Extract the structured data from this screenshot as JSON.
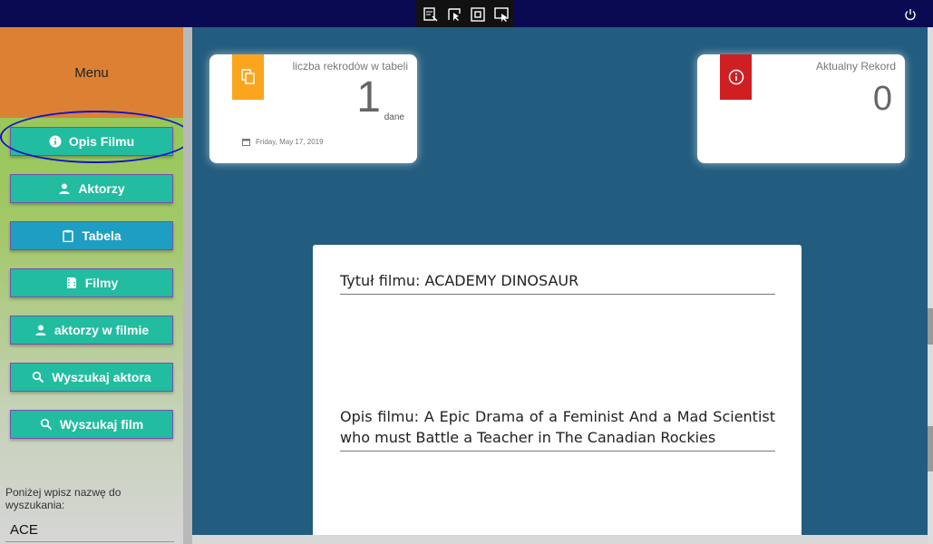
{
  "toolbar": {
    "tools": [
      "select-window-icon",
      "pointer-select-icon",
      "rectangle-select-icon",
      "fullscreen-select-icon"
    ],
    "power_icon": "power-icon"
  },
  "sidebar": {
    "menu_title": "Menu",
    "items": [
      {
        "label": "Opis Filmu",
        "icon": "info-icon"
      },
      {
        "label": "Aktorzy",
        "icon": "person-icon"
      },
      {
        "label": "Tabela",
        "icon": "clipboard-icon"
      },
      {
        "label": "Filmy",
        "icon": "film-icon"
      },
      {
        "label": "aktorzy w filmie",
        "icon": "person-icon"
      },
      {
        "label": "Wyszukaj aktora",
        "icon": "search-icon"
      },
      {
        "label": "Wyszukaj film",
        "icon": "search-icon"
      }
    ],
    "search_label": "Poniżej wpisz nazwę do wyszukania:",
    "search_value": "ACE"
  },
  "cards": {
    "count": {
      "label": "liczba rekrodów w tabeli",
      "value": "1",
      "unit": "dane",
      "date": "Friday, May 17, 2019",
      "icon": "copy-icon"
    },
    "current": {
      "label": "Aktualny Rekord",
      "value": "0",
      "icon": "info-icon"
    }
  },
  "details": {
    "title_line": "Tytuł filmu: ACADEMY DINOSAUR",
    "description_line": "Opis filmu: A Epic Drama of a Feminist And a Mad Scientist who must Battle a Teacher in The Canadian Rockies"
  },
  "colors": {
    "accent_green": "#22bca0",
    "accent_blue": "#1e9ec2",
    "menu_orange": "#dc8134",
    "main_bg": "#225c7e",
    "tag_orange": "#fba51f",
    "tag_red": "#cf1f23",
    "highlight_circle": "#1212cc"
  }
}
